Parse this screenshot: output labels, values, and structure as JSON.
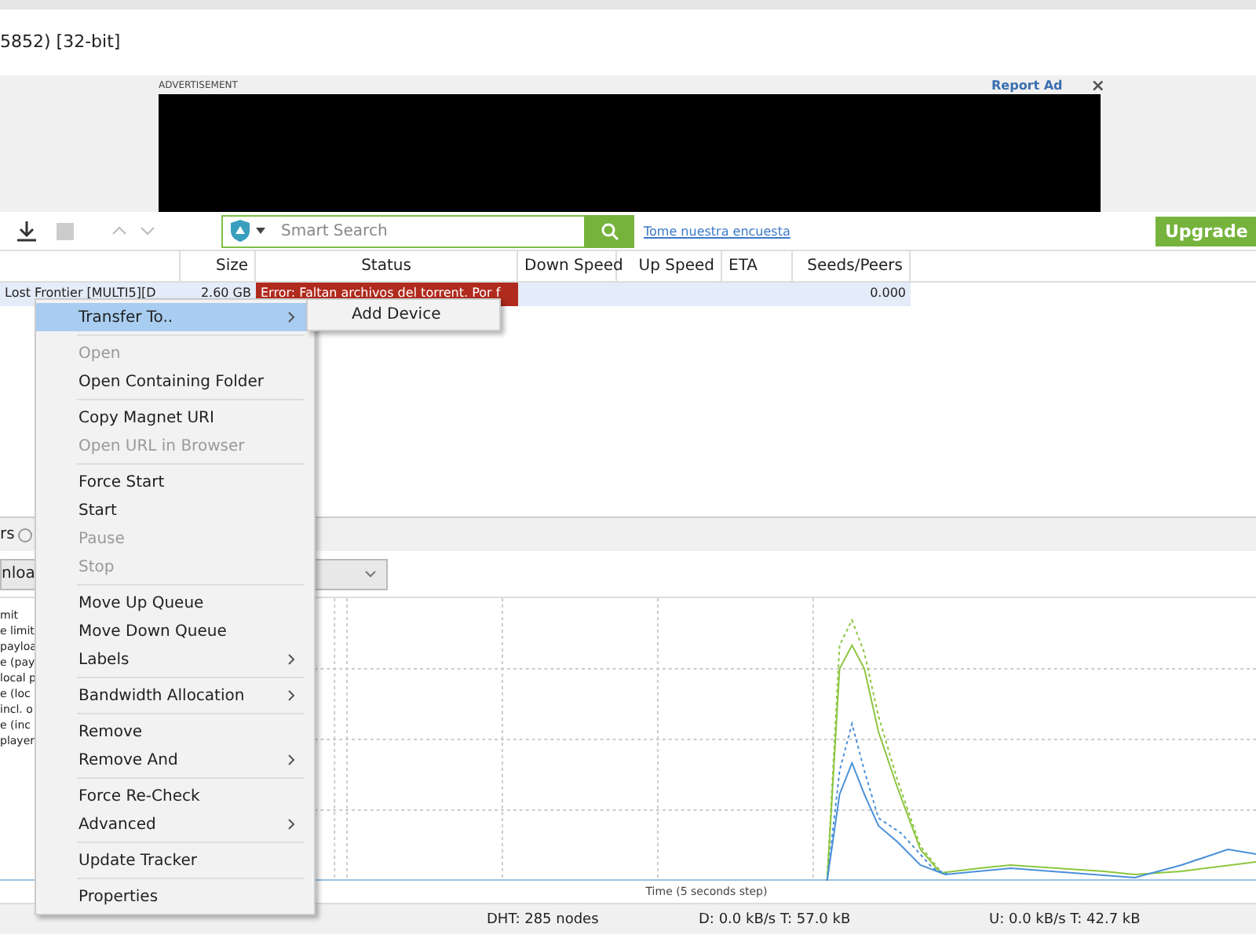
{
  "window": {
    "title": "5852) [32-bit]"
  },
  "ad": {
    "label": "ADVERTISEMENT",
    "report": "Report Ad",
    "close": "×"
  },
  "toolbar": {
    "search": {
      "placeholder": "Smart Search"
    },
    "survey_link": "Tome nuestra encuesta",
    "upgrade": "Upgrade"
  },
  "table": {
    "columns": [
      "Size",
      "Status",
      "Down Speed",
      "Up Speed",
      "ETA",
      "Seeds/Peers"
    ],
    "rows": [
      {
        "name": "Lost Frontier [MULTI5][D",
        "size": "2.60 GB",
        "status": "Error: Faltan archivos del torrent. Por f",
        "down": "",
        "up": "",
        "eta": "",
        "seeds": "0.000",
        "selected": true
      }
    ]
  },
  "bottom_panel": {
    "tab": "rs",
    "dropdown": "nloa",
    "legend": [
      "mit",
      "e limit",
      "payloa",
      "e (pay",
      "local p",
      "e (loc",
      "incl. o",
      "e (inc",
      "player"
    ],
    "time_label": "Time (5 seconds step)"
  },
  "status_bar": {
    "dht": "DHT: 285 nodes",
    "down": "D: 0.0 kB/s T: 57.0 kB",
    "up": "U: 0.0 kB/s T: 42.7 kB"
  },
  "context_menu": {
    "items": [
      {
        "kind": "item",
        "label": "Transfer To..",
        "disabled": false,
        "submenu": true,
        "selected": true
      },
      {
        "kind": "separator"
      },
      {
        "kind": "item",
        "label": "Open",
        "disabled": true,
        "submenu": false,
        "selected": false
      },
      {
        "kind": "item",
        "label": "Open Containing Folder",
        "disabled": false,
        "submenu": false,
        "selected": false
      },
      {
        "kind": "separator"
      },
      {
        "kind": "item",
        "label": "Copy Magnet URI",
        "disabled": false,
        "submenu": false,
        "selected": false
      },
      {
        "kind": "item",
        "label": "Open URL in Browser",
        "disabled": true,
        "submenu": false,
        "selected": false
      },
      {
        "kind": "separator"
      },
      {
        "kind": "item",
        "label": "Force Start",
        "disabled": false,
        "submenu": false,
        "selected": false
      },
      {
        "kind": "item",
        "label": "Start",
        "disabled": false,
        "submenu": false,
        "selected": false
      },
      {
        "kind": "item",
        "label": "Pause",
        "disabled": true,
        "submenu": false,
        "selected": false
      },
      {
        "kind": "item",
        "label": "Stop",
        "disabled": true,
        "submenu": false,
        "selected": false
      },
      {
        "kind": "separator"
      },
      {
        "kind": "item",
        "label": "Move Up Queue",
        "disabled": false,
        "submenu": false,
        "selected": false
      },
      {
        "kind": "item",
        "label": "Move Down Queue",
        "disabled": false,
        "submenu": false,
        "selected": false
      },
      {
        "kind": "item",
        "label": "Labels",
        "disabled": false,
        "submenu": true,
        "selected": false
      },
      {
        "kind": "separator"
      },
      {
        "kind": "item",
        "label": "Bandwidth Allocation",
        "disabled": false,
        "submenu": true,
        "selected": false
      },
      {
        "kind": "separator"
      },
      {
        "kind": "item",
        "label": "Remove",
        "disabled": false,
        "submenu": false,
        "selected": false
      },
      {
        "kind": "item",
        "label": "Remove And",
        "disabled": false,
        "submenu": true,
        "selected": false
      },
      {
        "kind": "separator"
      },
      {
        "kind": "item",
        "label": "Force Re-Check",
        "disabled": false,
        "submenu": false,
        "selected": false
      },
      {
        "kind": "item",
        "label": "Advanced",
        "disabled": false,
        "submenu": true,
        "selected": false
      },
      {
        "kind": "separator"
      },
      {
        "kind": "item",
        "label": "Update Tracker",
        "disabled": false,
        "submenu": false,
        "selected": false
      },
      {
        "kind": "separator"
      },
      {
        "kind": "item",
        "label": "Properties",
        "disabled": false,
        "submenu": false,
        "selected": false
      }
    ],
    "submenu": {
      "items": [
        "Add Device"
      ]
    }
  }
}
